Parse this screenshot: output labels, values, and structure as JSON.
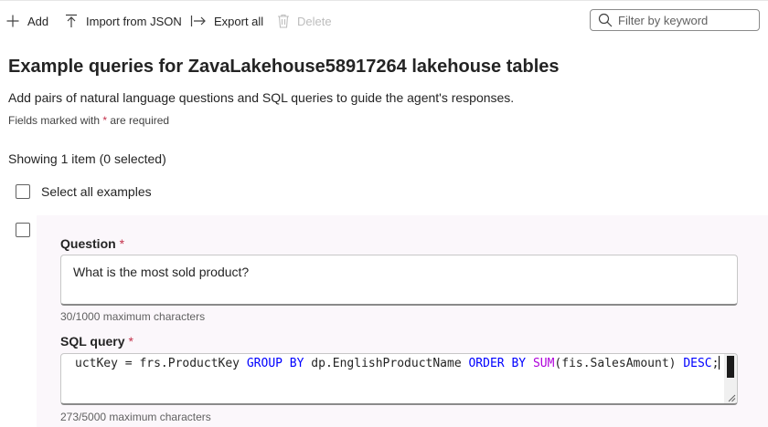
{
  "toolbar": {
    "add_label": "Add",
    "import_label": "Import from JSON",
    "export_label": "Export all",
    "delete_label": "Delete",
    "search_placeholder": "Filter by keyword"
  },
  "header": {
    "title": "Example queries for ZavaLakehouse58917264 lakehouse tables",
    "description": "Add pairs of natural language questions and SQL queries to guide the agent's responses.",
    "required_note_prefix": "Fields marked with ",
    "required_star": "*",
    "required_note_suffix": " are required"
  },
  "list": {
    "showing_text": "Showing 1 item (0 selected)",
    "select_all_label": "Select all examples"
  },
  "example": {
    "question_label": "Question",
    "question_value": "What is the most sold product?",
    "question_counter": "30/1000 maximum characters",
    "sql_label": "SQL query",
    "sql_tokens": {
      "t1": "uctKey = frs.ProductKey ",
      "t2": "GROUP BY",
      "t3": " dp.EnglishProductName ",
      "t4": "ORDER BY",
      "t5": " ",
      "t6": "SUM",
      "t7": "(fis.SalesAmount) ",
      "t8": "DESC",
      "t9": ";"
    },
    "sql_counter": "273/5000 maximum characters",
    "required_star": "*"
  },
  "colors": {
    "keyword": "#0000ff",
    "function": "#af00db",
    "required": "#c4314b",
    "card_background": "#fbf7fb"
  },
  "icons": [
    "add-icon",
    "import-icon",
    "export-icon",
    "delete-icon",
    "search-icon",
    "resize-handle-icon"
  ]
}
